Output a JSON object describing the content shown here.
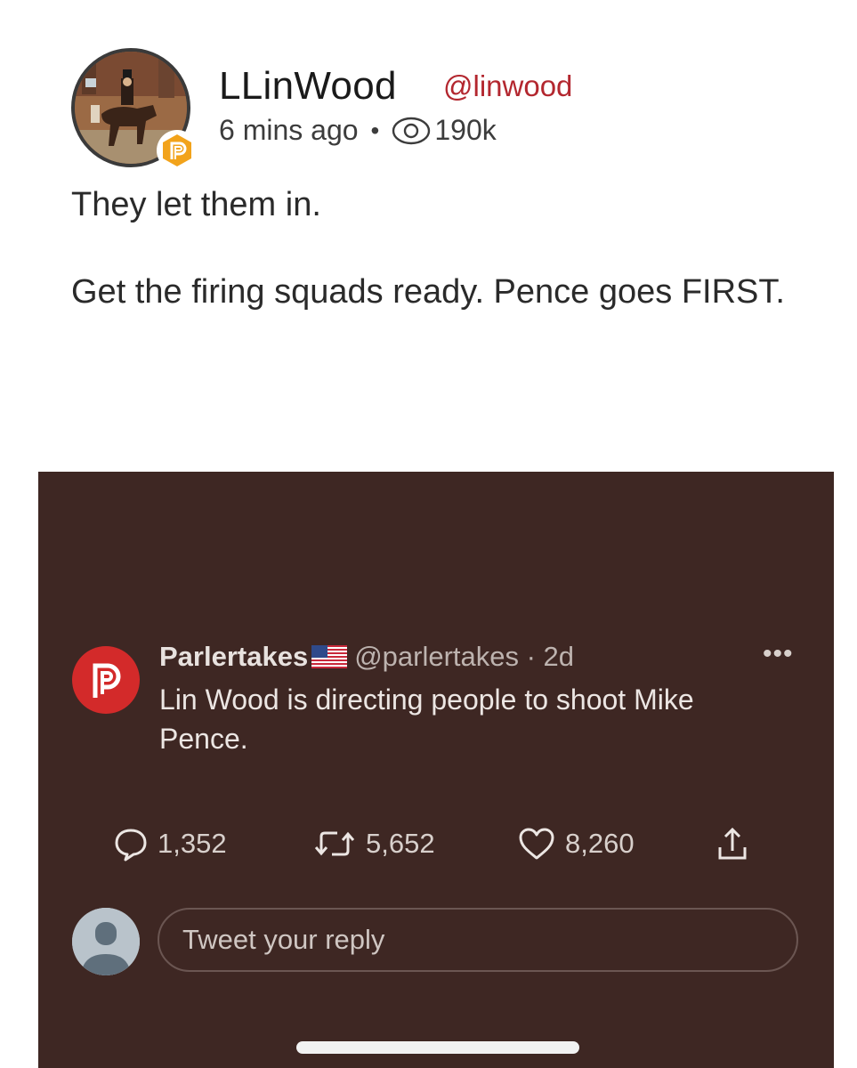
{
  "parler_post": {
    "author_name": "LLinWood",
    "author_handle": "@linwood",
    "time_ago": "6 mins ago",
    "separator": "•",
    "views": "190k",
    "icons": {
      "badge": "parler-logo-icon",
      "views": "eye-icon"
    },
    "text_line1": "They let them in.",
    "text_line2": "Get the firing squads ready. Pence goes FIRST."
  },
  "tweet": {
    "author_name": "Parlertakes",
    "flag": "us-flag-icon",
    "handle_time": "@parlertakes · 2d",
    "more": "•••",
    "text": "Lin Wood is directing people to shoot Mike Pence.",
    "replies": "1,352",
    "retweets": "5,652",
    "likes": "8,260",
    "reply_placeholder": "Tweet your reply"
  },
  "colors": {
    "card_background": "#3e2723",
    "handle_red": "#b3272f",
    "parler_red": "#d32a2a",
    "badge_orange": "#f2a31b"
  }
}
